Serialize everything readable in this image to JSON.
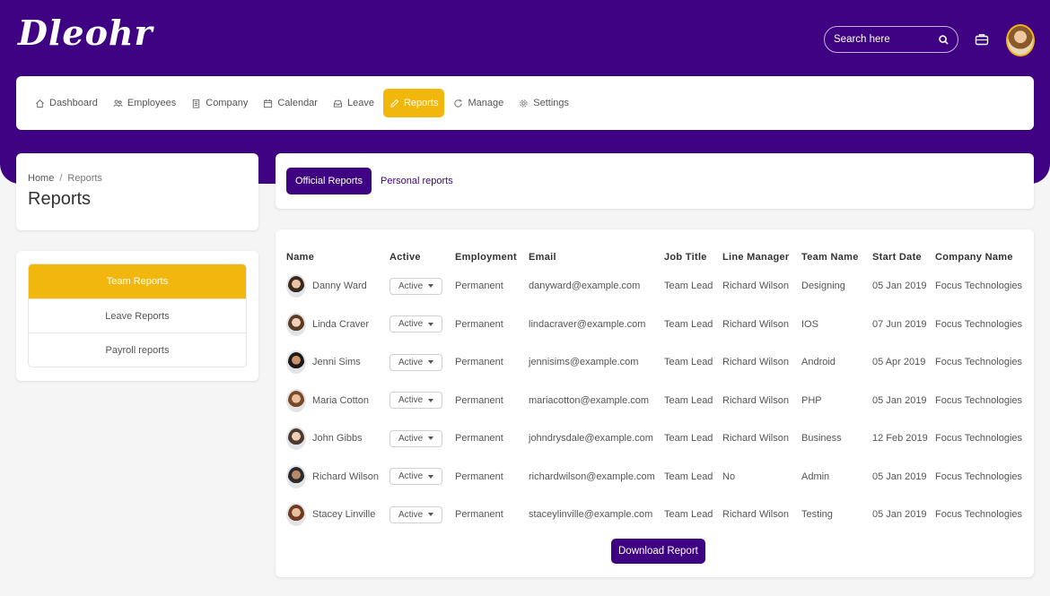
{
  "app": {
    "logo": "Dleohr"
  },
  "header": {
    "search_placeholder": "Search here"
  },
  "nav": [
    {
      "label": "Dashboard",
      "icon": "home-icon"
    },
    {
      "label": "Employees",
      "icon": "users-icon"
    },
    {
      "label": "Company",
      "icon": "building-icon"
    },
    {
      "label": "Calendar",
      "icon": "calendar-icon"
    },
    {
      "label": "Leave",
      "icon": "inbox-icon"
    },
    {
      "label": "Reports",
      "icon": "pencil-icon",
      "active": true
    },
    {
      "label": "Manage",
      "icon": "refresh-icon"
    },
    {
      "label": "Settings",
      "icon": "gear-icon"
    }
  ],
  "breadcrumb": {
    "home": "Home",
    "sep": "/",
    "current": "Reports"
  },
  "page_title": "Reports",
  "sidebar": {
    "items": [
      {
        "label": "Team Reports",
        "active": true
      },
      {
        "label": "Leave Reports"
      },
      {
        "label": "Payroll reports"
      }
    ]
  },
  "tabs": [
    {
      "label": "Official Reports",
      "active": true
    },
    {
      "label": "Personal reports"
    }
  ],
  "table": {
    "columns": [
      "Name",
      "Active",
      "Employment",
      "Email",
      "Job Title",
      "Line Manager",
      "Team Name",
      "Start Date",
      "Company Name"
    ],
    "rows": [
      {
        "name": "Danny Ward",
        "status": "Active",
        "employment": "Permanent",
        "email": "danyward@example.com",
        "job": "Team Lead",
        "manager": "Richard Wilson",
        "team": "Designing",
        "start": "05 Jan 2019",
        "company": "Focus Technologies"
      },
      {
        "name": "Linda Craver",
        "status": "Active",
        "employment": "Permanent",
        "email": "lindacraver@example.com",
        "job": "Team Lead",
        "manager": "Richard Wilson",
        "team": "IOS",
        "start": "07 Jun 2019",
        "company": "Focus Technologies"
      },
      {
        "name": "Jenni Sims",
        "status": "Active",
        "employment": "Permanent",
        "email": "jennisims@example.com",
        "job": "Team Lead",
        "manager": "Richard Wilson",
        "team": "Android",
        "start": "05 Apr 2019",
        "company": "Focus Technologies"
      },
      {
        "name": "Maria Cotton",
        "status": "Active",
        "employment": "Permanent",
        "email": "mariacotton@example.com",
        "job": "Team Lead",
        "manager": "Richard Wilson",
        "team": "PHP",
        "start": "05 Jan 2019",
        "company": "Focus Technologies"
      },
      {
        "name": "John Gibbs",
        "status": "Active",
        "employment": "Permanent",
        "email": "johndrysdale@example.com",
        "job": "Team Lead",
        "manager": "Richard Wilson",
        "team": "Business",
        "start": "12 Feb 2019",
        "company": "Focus Technologies"
      },
      {
        "name": "Richard Wilson",
        "status": "Active",
        "employment": "Permanent",
        "email": "richardwilson@example.com",
        "job": "Team Lead",
        "manager": "No",
        "team": "Admin",
        "start": "05 Jan 2019",
        "company": "Focus Technologies"
      },
      {
        "name": "Stacey Linville",
        "status": "Active",
        "employment": "Permanent",
        "email": "staceylinville@example.com",
        "job": "Team Lead",
        "manager": "Richard Wilson",
        "team": "Testing",
        "start": "05 Jan 2019",
        "company": "Focus Technologies"
      }
    ]
  },
  "download_label": "Download Report",
  "colors": {
    "brand": "#3e0283",
    "accent": "#f2b70d"
  }
}
